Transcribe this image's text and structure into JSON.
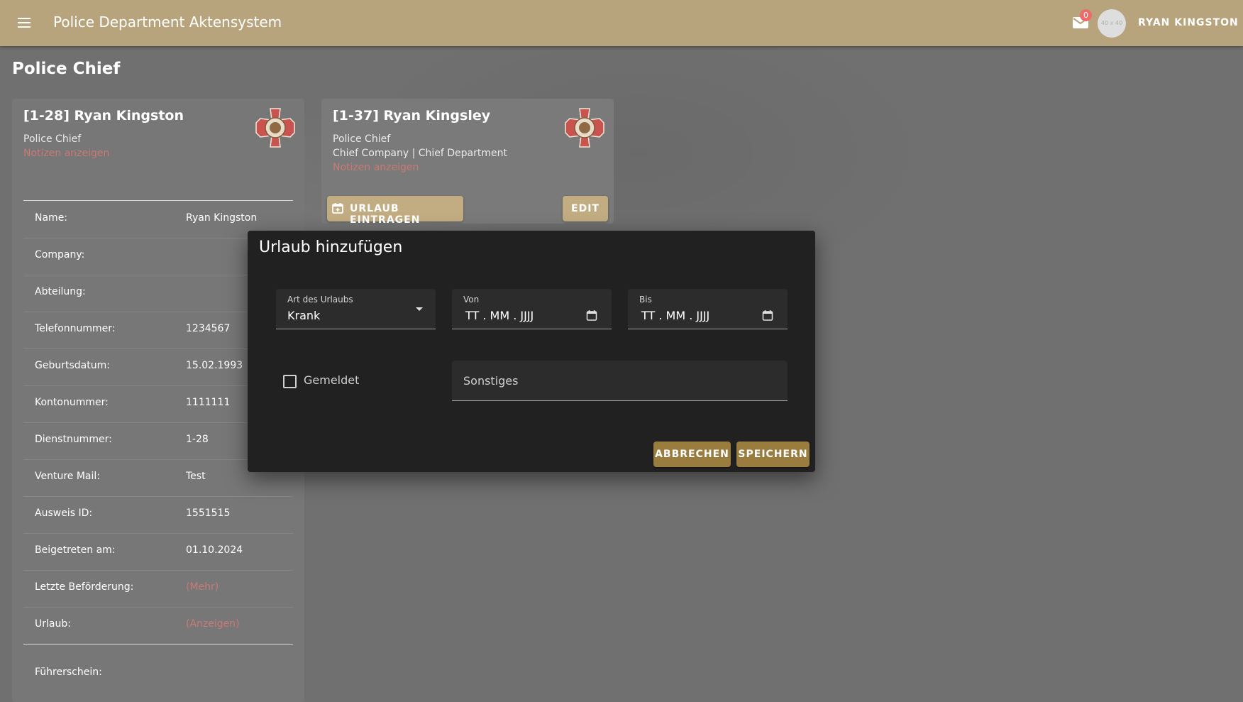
{
  "app": {
    "title": "Police Department Aktensystem"
  },
  "header": {
    "mail_count": "0",
    "avatar_placeholder": "40 x 40",
    "user_name": "RYAN KINGSTON"
  },
  "page": {
    "title": "Police Chief"
  },
  "card1": {
    "name": "[1-28] Ryan Kingston",
    "role": "Police Chief",
    "notes_link": "Notizen anzeigen",
    "rows": [
      {
        "label": "Name:",
        "value": "Ryan Kingston"
      },
      {
        "label": "Company:",
        "value": ""
      },
      {
        "label": "Abteilung:",
        "value": ""
      },
      {
        "label": "Telefonnummer:",
        "value": "1234567"
      },
      {
        "label": "Geburtsdatum:",
        "value": "15.02.1993"
      },
      {
        "label": "Kontonummer:",
        "value": "1111111"
      },
      {
        "label": "Dienstnummer:",
        "value": "1-28"
      },
      {
        "label": "Venture Mail:",
        "value": "Test"
      },
      {
        "label": "Ausweis ID:",
        "value": "1551515"
      },
      {
        "label": "Beigetreten am:",
        "value": "01.10.2024"
      },
      {
        "label": "Letzte Beförderung:",
        "value": "(Mehr)"
      },
      {
        "label": "Urlaub:",
        "value": "(Anzeigen)"
      },
      {
        "label": "Führerschein:",
        "value": ""
      }
    ]
  },
  "card2": {
    "name": "[1-37] Ryan Kingsley",
    "role": "Police Chief",
    "company": "Chief Company | Chief Department",
    "notes_link": "Notizen anzeigen",
    "urlaub_button": "URLAUB EINTRAGEN",
    "edit_button": "EDIT"
  },
  "dialog": {
    "title": "Urlaub hinzufügen",
    "art_label": "Art des Urlaubs",
    "art_value": "Krank",
    "von_label": "Von",
    "von_value": "TT . MM . JJJJ",
    "bis_label": "Bis",
    "bis_value": "TT . MM . JJJJ",
    "gemeldet_label": "Gemeldet",
    "gemeldet_checked": false,
    "sonstiges_placeholder": "Sonstiges",
    "cancel_button": "ABBRECHEN",
    "save_button": "SPEICHERN"
  },
  "colors": {
    "topbar": "#b7a37c",
    "link": "#c87a74",
    "button": "#c2ad82",
    "dialog_button": "#9a7d3e",
    "dialog_bg": "#212121"
  },
  "icons": {
    "menu": "menu-icon",
    "mail": "mail-icon",
    "calendar": "calendar-icon",
    "calendar_plus": "calendar-plus-icon",
    "dropdown": "chevron-down-icon",
    "department_badge": "fire-department-badge-icon"
  }
}
